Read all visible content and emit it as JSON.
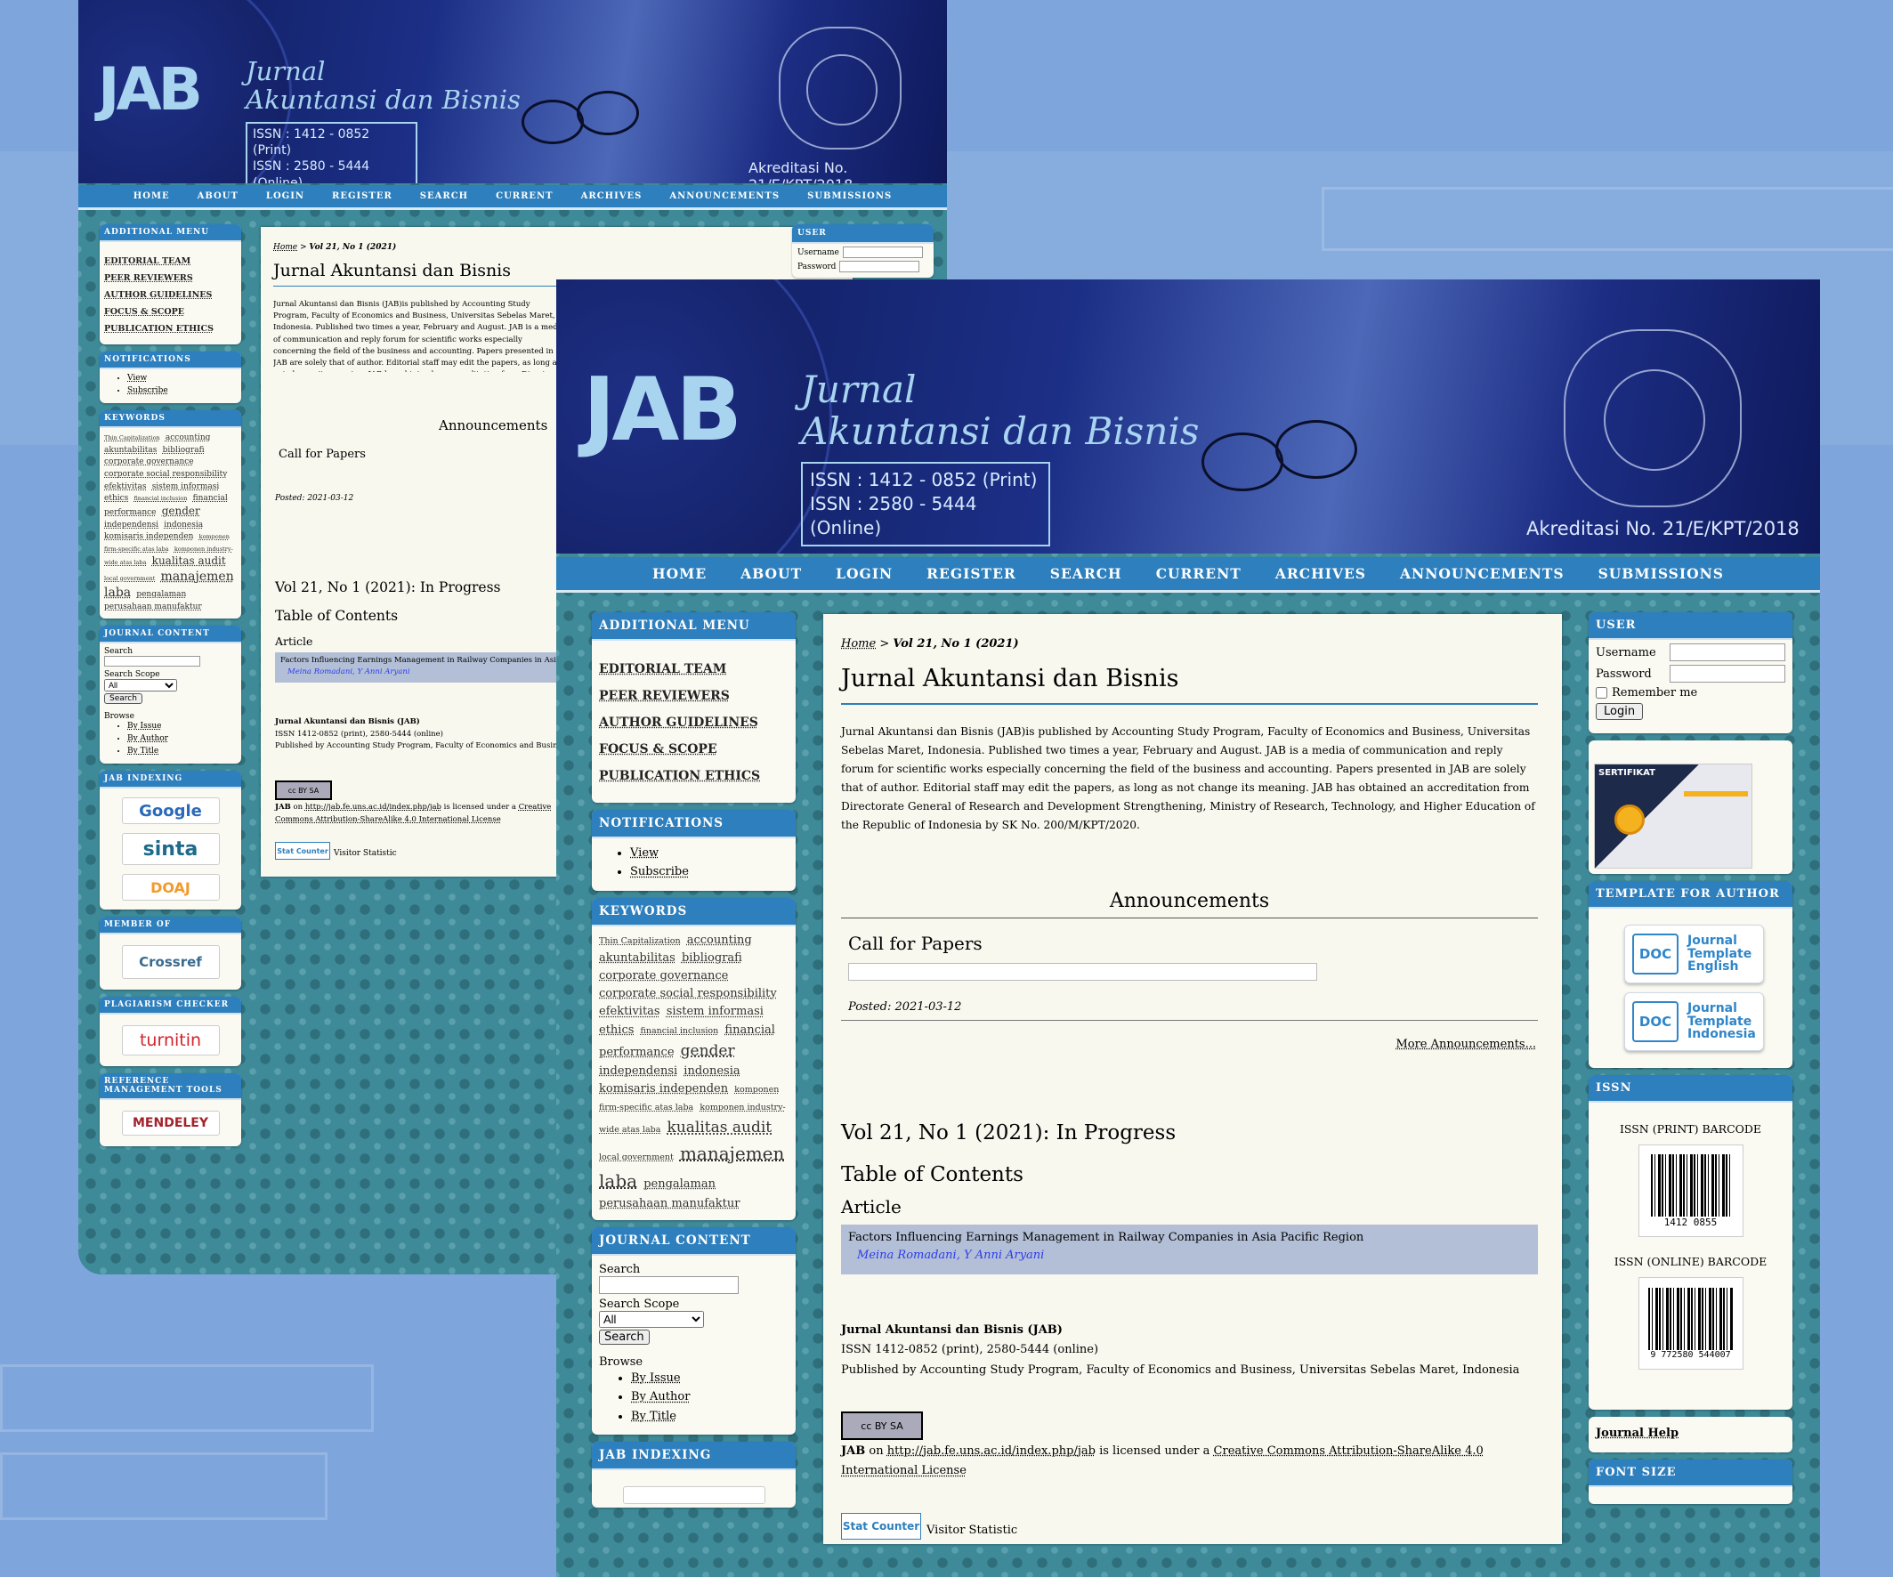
{
  "site": {
    "logo": "JAB",
    "title_line1": "Jurnal",
    "title_line2": "Akuntansi dan Bisnis",
    "issn_print": "ISSN : 1412 - 0852 (Print)",
    "issn_online": "ISSN : 2580 - 5444 (Online)",
    "accreditation": "Akreditasi No. 21/E/KPT/2018"
  },
  "nav": [
    "HOME",
    "ABOUT",
    "LOGIN",
    "REGISTER",
    "SEARCH",
    "CURRENT",
    "ARCHIVES",
    "ANNOUNCEMENTS",
    "SUBMISSIONS"
  ],
  "additional_menu": {
    "title": "ADDITIONAL MENU",
    "items": [
      "EDITORIAL TEAM",
      "PEER REVIEWERS",
      "AUTHOR GUIDELINES",
      "FOCUS & SCOPE",
      "PUBLICATION ETHICS"
    ]
  },
  "notifications": {
    "title": "NOTIFICATIONS",
    "items": [
      "View",
      "Subscribe"
    ]
  },
  "keywords": {
    "title": "KEYWORDS",
    "tags": [
      {
        "t": "Thin Capitalization",
        "s": 1
      },
      {
        "t": "accounting",
        "s": 2
      },
      {
        "t": "akuntabilitas",
        "s": 2
      },
      {
        "t": "bibliografi",
        "s": 2
      },
      {
        "t": "corporate governance",
        "s": 2
      },
      {
        "t": "corporate social responsibility",
        "s": 2
      },
      {
        "t": "efektivitas",
        "s": 2
      },
      {
        "t": "sistem informasi",
        "s": 2
      },
      {
        "t": "ethics",
        "s": 2
      },
      {
        "t": "financial inclusion",
        "s": 1
      },
      {
        "t": "financial performance",
        "s": 2
      },
      {
        "t": "gender",
        "s": 3
      },
      {
        "t": "independensi",
        "s": 2
      },
      {
        "t": "indonesia",
        "s": 2
      },
      {
        "t": "komisaris independen",
        "s": 2
      },
      {
        "t": "komponen firm-specific atas laba",
        "s": 1
      },
      {
        "t": "komponen industry-wide atas laba",
        "s": 1
      },
      {
        "t": "kualitas audit",
        "s": 3
      },
      {
        "t": "local government",
        "s": 1
      },
      {
        "t": "manajemen laba",
        "s": 4
      },
      {
        "t": "pengalaman",
        "s": 2
      },
      {
        "t": "perusahaan manufaktur",
        "s": 2
      }
    ]
  },
  "journal_content": {
    "title": "JOURNAL CONTENT",
    "search_label": "Search",
    "scope_label": "Search Scope",
    "scope_value": "All",
    "search_button": "Search",
    "browse_label": "Browse",
    "browse_items": [
      "By Issue",
      "By Author",
      "By Title"
    ]
  },
  "jab_indexing": {
    "title": "JAB INDEXING",
    "items": [
      "Google",
      "sinta",
      "DOAJ"
    ]
  },
  "member_of": {
    "title": "MEMBER OF",
    "item": "Crossref"
  },
  "plagiarism": {
    "title": "PLAGIARISM CHECKER",
    "item": "turnitin"
  },
  "reference_tools": {
    "title": "REFERENCE MANAGEMENT TOOLS",
    "item": "MENDELEY"
  },
  "main": {
    "breadcrumb_home": "Home",
    "breadcrumb_sep": " > ",
    "breadcrumb_current": "Vol 21, No 1 (2021)",
    "heading": "Jurnal Akuntansi dan Bisnis",
    "description": "Jurnal Akuntansi dan Bisnis (JAB)is published by Accounting Study Program, Faculty of Economics and Business, Universitas Sebelas Maret, Indonesia. Published two times a year, February and August. JAB is a media of communication and reply forum for scientific works especially concerning the field of the business and accounting. Papers presented in JAB are solely that of author. Editorial staff may edit the papers, as long as not change its meaning. JAB has obtained an accreditation from Directorate General of Research and Development Strengthening, Ministry of Research, Technology, and Higher Education of the Republic of Indonesia by SK No. 200/M/KPT/2020.",
    "announcements_title": "Announcements",
    "announcement_title": "Call for Papers",
    "posted": "Posted: 2021-03-12",
    "more_announcements": "More Announcements...",
    "issue_title": "Vol 21, No 1 (2021): In Progress",
    "toc_title": "Table of Contents",
    "section": "Article",
    "article_title": "Factors Influencing Earnings Management in Railway Companies in Asia Pacific Region",
    "article_authors": "Meina Romadani, Y Anni Aryani",
    "footer_name": "Jurnal Akuntansi dan Bisnis (JAB)",
    "footer_issn": "ISSN 1412-0852 (print), 2580-5444 (online)",
    "footer_pub": "Published by Accounting Study Program, Faculty of Economics and Business, Universitas Sebelas Maret, Indonesia",
    "license_jab": "JAB",
    "license_on": " on ",
    "license_url": "http://jab.fe.uns.ac.id/index.php/jab",
    "license_mid": " is licensed under a ",
    "license_name": "Creative Commons Attribution-ShareAlike 4.0 International License",
    "cc_badge": "cc BY SA",
    "statcounter": "Stat Counter",
    "visitor": "Visitor Statistic"
  },
  "user": {
    "title": "USER",
    "username_label": "Username",
    "password_label": "Password",
    "remember": "Remember me",
    "login_button": "Login"
  },
  "sertifikat": "SERTIFIKAT",
  "template": {
    "title": "TEMPLATE FOR AUTHOR",
    "doc": "DOC",
    "english": [
      "Journal",
      "Template",
      "English"
    ],
    "indonesia": [
      "Journal",
      "Template",
      "Indonesia"
    ]
  },
  "issn_block": {
    "title": "ISSN",
    "print_label": "ISSN (PRINT) BARCODE",
    "print_digits": "1412 0855",
    "online_label": "ISSN (ONLINE) BARCODE",
    "online_digits": "9 772580 544007"
  },
  "journal_help": "Journal Help",
  "font_size": "FONT SIZE",
  "colors": {
    "nav": "#2d7fbd",
    "banner": "#1c2f86",
    "pattern": "#3e8a98",
    "link": "#2a3cf0"
  }
}
